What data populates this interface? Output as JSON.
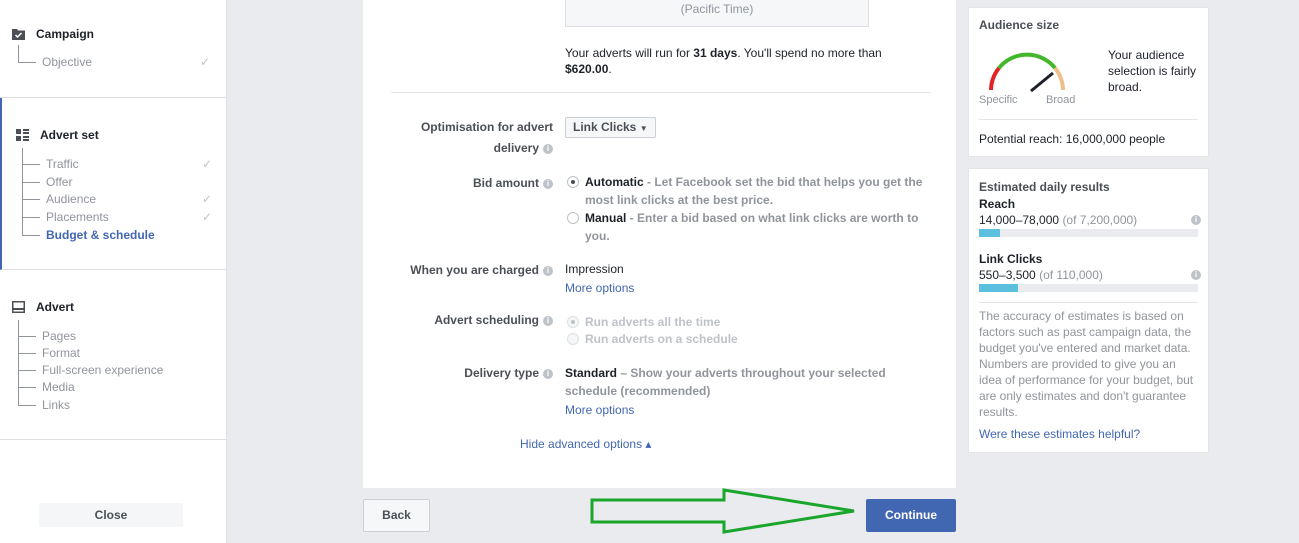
{
  "sidebar": {
    "campaign": {
      "title": "Campaign",
      "items": [
        {
          "label": "Objective",
          "done": "✓"
        }
      ]
    },
    "advert_set": {
      "title": "Advert set",
      "items": [
        {
          "label": "Traffic",
          "done": "✓"
        },
        {
          "label": "Offer",
          "done": ""
        },
        {
          "label": "Audience",
          "done": "✓"
        },
        {
          "label": "Placements",
          "done": "✓"
        },
        {
          "label": "Budget & schedule",
          "done": ""
        }
      ]
    },
    "advert": {
      "title": "Advert",
      "items": [
        {
          "label": "Pages"
        },
        {
          "label": "Format"
        },
        {
          "label": "Full-screen experience"
        },
        {
          "label": "Media"
        },
        {
          "label": "Links"
        }
      ]
    },
    "close_label": "Close"
  },
  "main": {
    "timezone": "(Pacific Time)",
    "run_prefix": "Your adverts will run for ",
    "run_days": "31 days",
    "run_mid": ". You'll spend no more than ",
    "run_amount": "$620.00",
    "run_suffix": ".",
    "optimisation_label_1": "Optimisation for advert",
    "optimisation_label_2": "delivery",
    "optimisation_value": "Link Clicks",
    "bid_label": "Bid amount",
    "bid_auto_title": "Automatic",
    "bid_auto_desc": " - Let Facebook set the bid that helps you get the most link clicks at the best price.",
    "bid_manual_title": "Manual",
    "bid_manual_desc": " - Enter a bid based on what link clicks are worth to you.",
    "charged_label": "When you are charged",
    "charged_value": "Impression",
    "more_options": "More options",
    "scheduling_label": "Advert scheduling",
    "sched_all": "Run adverts all the time",
    "sched_schedule": "Run adverts on a schedule",
    "delivery_label": "Delivery type",
    "delivery_title": "Standard",
    "delivery_desc": " – Show your adverts throughout your selected schedule (recommended)",
    "hide_advanced": "Hide advanced options ▴",
    "back_label": "Back",
    "continue_label": "Continue"
  },
  "audience": {
    "title": "Audience size",
    "gauge_specific": "Specific",
    "gauge_broad": "Broad",
    "desc": "Your audience selection is fairly broad.",
    "potential_reach": "Potential reach: 16,000,000 people"
  },
  "estimates": {
    "title": "Estimated daily results",
    "reach_label": "Reach",
    "reach_range": "14,000–78,000",
    "reach_total": "(of 7,200,000)",
    "reach_fraction": 0.095,
    "clicks_label": "Link Clicks",
    "clicks_range": "550–3,500",
    "clicks_total": "(of 110,000)",
    "clicks_fraction": 0.18,
    "note": "The accuracy of estimates is based on factors such as past campaign data, the budget you've entered and market data. Numbers are provided to give you an idea of performance for your budget, but are only estimates and don't guarantee results.",
    "helpful_link": "Were these estimates helpful?"
  },
  "colors": {
    "accent": "#4267b2",
    "bar": "#5bc0de",
    "arrow": "#1aa52c"
  }
}
